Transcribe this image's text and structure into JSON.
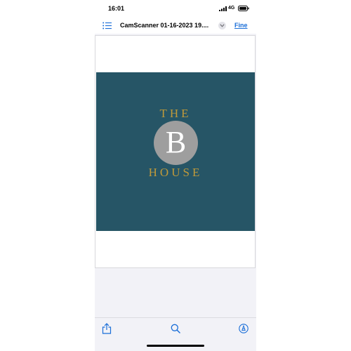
{
  "status_bar": {
    "time": "16:01",
    "network": "4G"
  },
  "nav_bar": {
    "title": "CamScanner 01-16-2023 19....",
    "done_label": "Fine"
  },
  "document": {
    "logo": {
      "line_top": "THE",
      "monogram": "B",
      "line_bottom": "HOUSE"
    }
  },
  "icons": {
    "list": "list-icon",
    "dropdown": "chevron-down-icon",
    "share": "share-icon",
    "search": "search-icon",
    "markup": "markup-icon",
    "signal": "signal-icon",
    "battery": "battery-icon"
  },
  "colors": {
    "accent": "#1a6ed8",
    "logo_background": "#265566",
    "logo_gold": "#c09a3a",
    "logo_circle": "#9e9e9e"
  }
}
